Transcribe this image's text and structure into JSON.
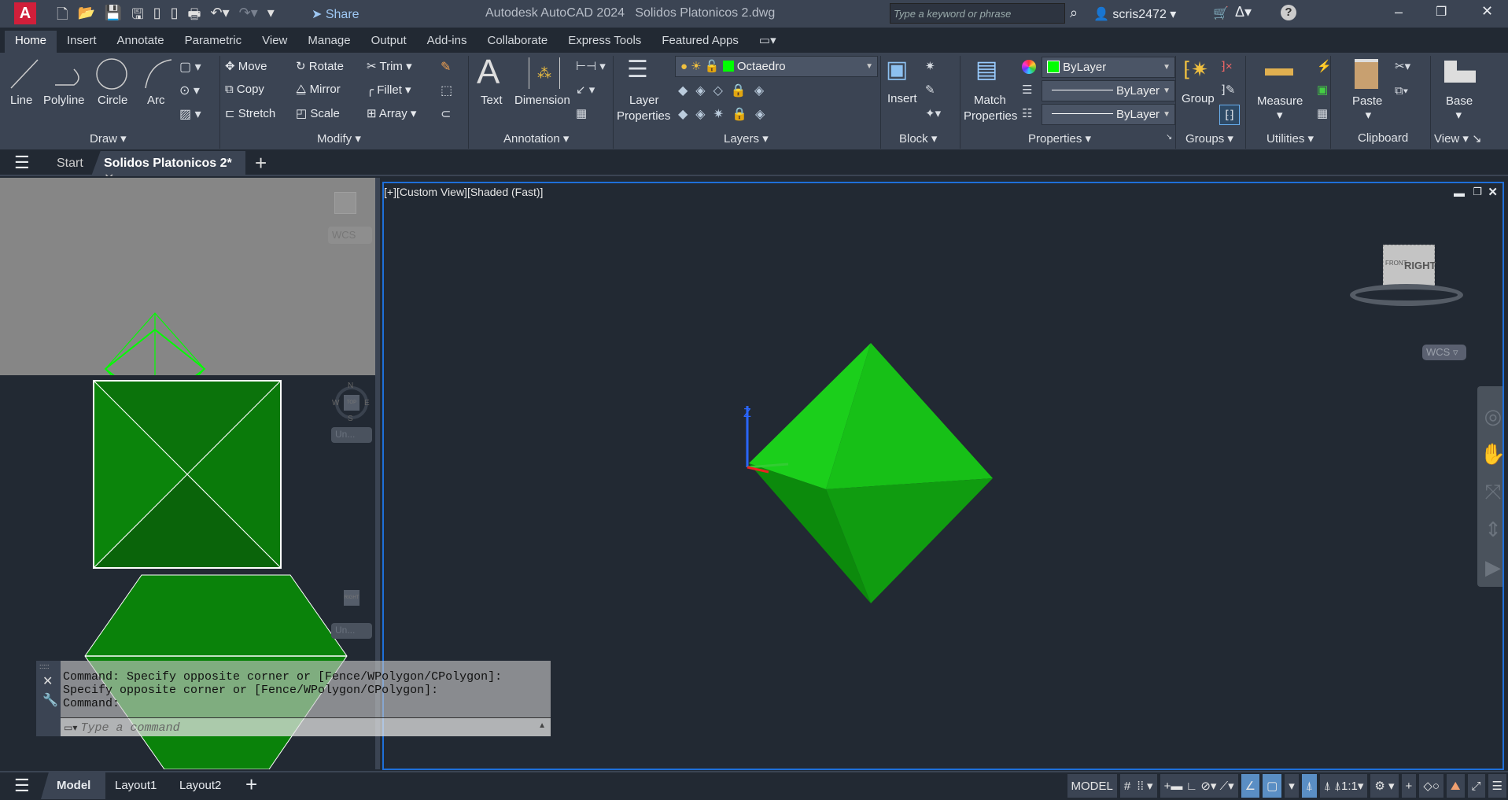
{
  "titlebar": {
    "app_letter": "A",
    "share": "Share",
    "title": "Autodesk AutoCAD 2024",
    "document": "Solidos Platonicos 2.dwg",
    "search_placeholder": "Type a keyword or phrase",
    "user": "scris2472"
  },
  "ribbon_tabs": [
    "Home",
    "Insert",
    "Annotate",
    "Parametric",
    "View",
    "Manage",
    "Output",
    "Add-ins",
    "Collaborate",
    "Express Tools",
    "Featured Apps"
  ],
  "ribbon": {
    "draw": {
      "label": "Draw",
      "items": [
        "Line",
        "Polyline",
        "Circle",
        "Arc"
      ]
    },
    "modify": {
      "label": "Modify",
      "items": [
        "Move",
        "Rotate",
        "Trim",
        "Copy",
        "Mirror",
        "Fillet",
        "Stretch",
        "Scale",
        "Array"
      ]
    },
    "annotation": {
      "label": "Annotation",
      "items": [
        "Text",
        "Dimension"
      ]
    },
    "layers": {
      "label": "Layers",
      "layer_properties": [
        "Layer",
        "Properties"
      ],
      "current_layer": "Octaedro"
    },
    "block": {
      "label": "Block",
      "insert": "Insert"
    },
    "properties": {
      "label": "Properties",
      "match": [
        "Match",
        "Properties"
      ],
      "color": "ByLayer",
      "linetype": "ByLayer",
      "lineweight": "ByLayer"
    },
    "groups": {
      "label": "Groups",
      "group": "Group"
    },
    "utilities": {
      "label": "Utilities",
      "measure": "Measure"
    },
    "clipboard": {
      "label": "Clipboard",
      "paste": "Paste"
    },
    "view": {
      "label": "View",
      "base": "Base"
    }
  },
  "doc_tabs": {
    "start": "Start",
    "active": "Solidos Platonicos 2*"
  },
  "viewport": {
    "label": "[+][Custom View][Shaded (Fast)]",
    "viewcube_face": "RIGHT",
    "viewcube_front": "FRONT",
    "wcs": "WCS",
    "axis_z": "Z"
  },
  "small_viewports": {
    "wcs": "WCS",
    "un1": "Un...",
    "un2": "Un...",
    "compass": [
      "N",
      "W",
      "E",
      "S"
    ],
    "top_face": "TOP",
    "right_face": "RIGHT"
  },
  "command": {
    "history": [
      "Command: Specify opposite corner or [Fence/WPolygon/CPolygon]:",
      "Specify opposite corner or [Fence/WPolygon/CPolygon]:",
      "Command:"
    ],
    "placeholder": "Type a command"
  },
  "layout_tabs": [
    "Model",
    "Layout1",
    "Layout2"
  ],
  "status": {
    "model": "MODEL",
    "scale": "1:1"
  },
  "colors": {
    "accent": "#1e6fd9",
    "object_green": "#00ff00",
    "layer_swatch": "#00ff00"
  }
}
